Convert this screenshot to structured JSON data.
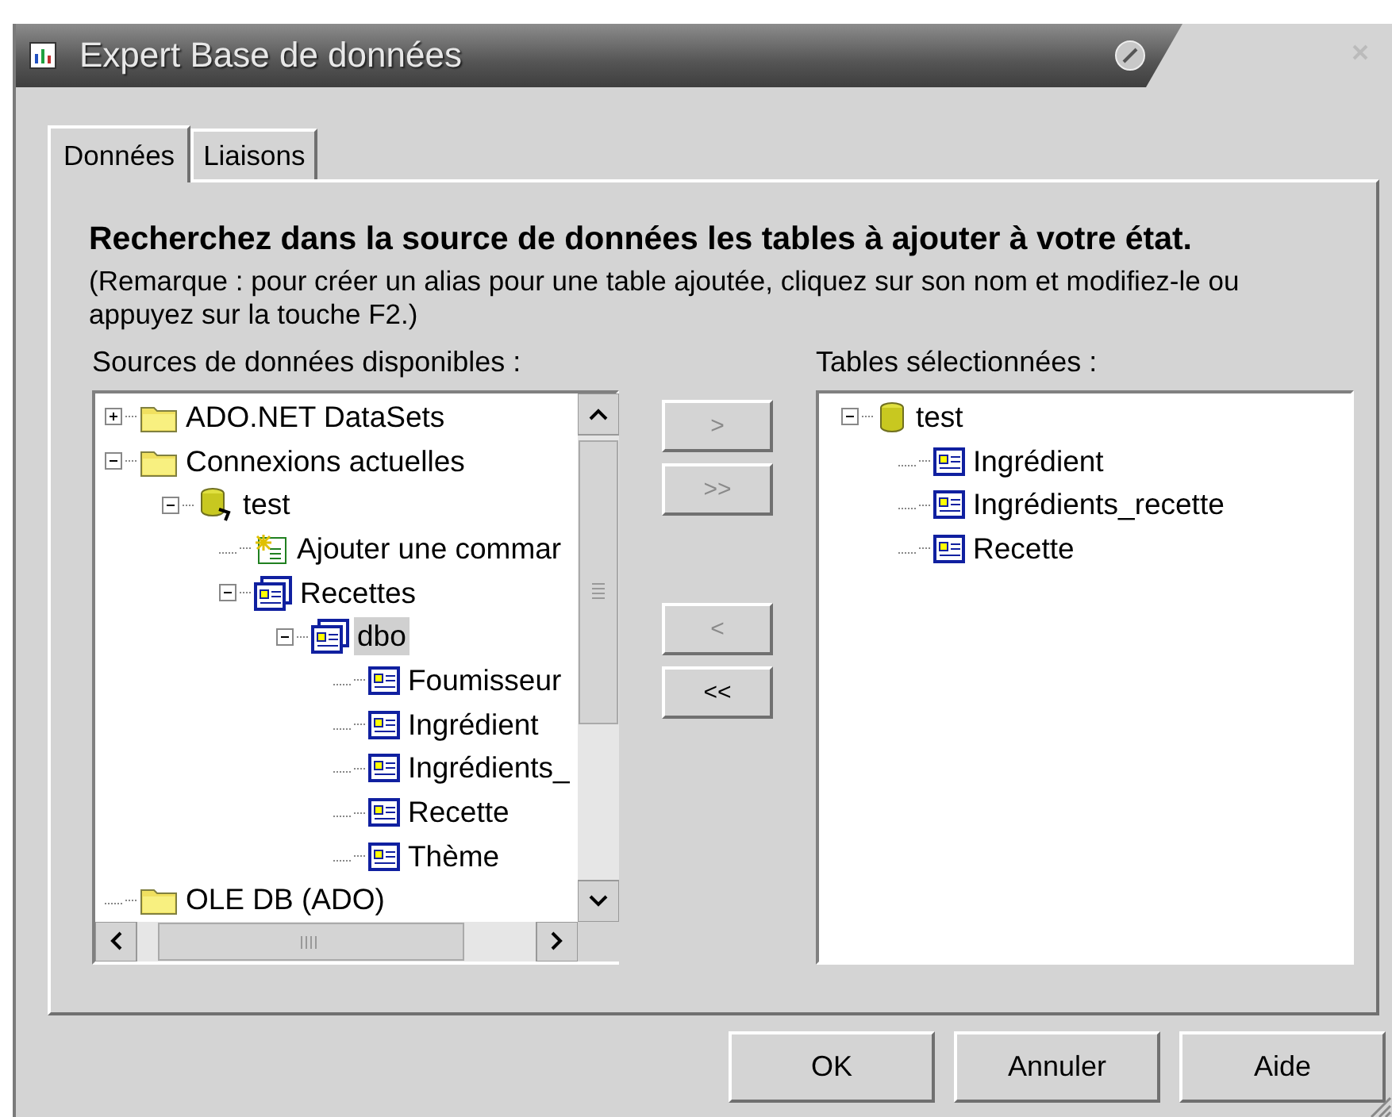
{
  "window": {
    "title": "Expert Base de données"
  },
  "tabs": [
    {
      "label": "Données",
      "selected": true
    },
    {
      "label": "Liaisons",
      "selected": false
    }
  ],
  "heading": "Recherchez dans la source de données les tables à ajouter à votre état.",
  "note": "(Remarque : pour créer un alias pour une table ajoutée, cliquez sur son nom et modifiez-le ou appuyez sur la touche F2.)",
  "available": {
    "label": "Sources de données disponibles :",
    "tree": [
      {
        "label": "ADO.NET DataSets",
        "kind": "folder",
        "expanded": false,
        "selected": false
      },
      {
        "label": "Connexions actuelles",
        "kind": "folder",
        "expanded": true,
        "selected": false,
        "children": [
          {
            "label": "test",
            "kind": "connection",
            "expanded": true,
            "selected": false,
            "children": [
              {
                "label": "Ajouter une commar",
                "kind": "command",
                "selected": false
              },
              {
                "label": "Recettes",
                "kind": "schema",
                "expanded": true,
                "selected": false,
                "children": [
                  {
                    "label": "dbo",
                    "kind": "schema",
                    "expanded": true,
                    "selected": true,
                    "children": [
                      {
                        "label": "Foumisseur",
                        "kind": "table",
                        "selected": false
                      },
                      {
                        "label": "Ingrédient",
                        "kind": "table",
                        "selected": false
                      },
                      {
                        "label": "Ingrédients_",
                        "kind": "table",
                        "selected": false
                      },
                      {
                        "label": "Recette",
                        "kind": "table",
                        "selected": false
                      },
                      {
                        "label": "Thème",
                        "kind": "table",
                        "selected": false
                      }
                    ]
                  }
                ]
              }
            ]
          }
        ]
      },
      {
        "label": "OLE DB (ADO)",
        "kind": "folder",
        "selected": false
      }
    ]
  },
  "move_buttons": [
    {
      "label": ">",
      "disabled": true
    },
    {
      "label": ">>",
      "disabled": true
    },
    {
      "label": "<",
      "disabled": true
    },
    {
      "label": "<<",
      "disabled": false
    }
  ],
  "selected_tables": {
    "label": "Tables sélectionnées :",
    "tree": [
      {
        "label": "test",
        "kind": "database",
        "expanded": true,
        "selected": false,
        "children": [
          {
            "label": "Ingrédient",
            "kind": "table",
            "selected": false
          },
          {
            "label": "Ingrédients_recette",
            "kind": "table",
            "selected": false
          },
          {
            "label": "Recette",
            "kind": "table",
            "selected": false
          }
        ]
      }
    ]
  },
  "buttons": [
    {
      "label": "OK"
    },
    {
      "label": "Annuler"
    },
    {
      "label": "Aide"
    }
  ]
}
